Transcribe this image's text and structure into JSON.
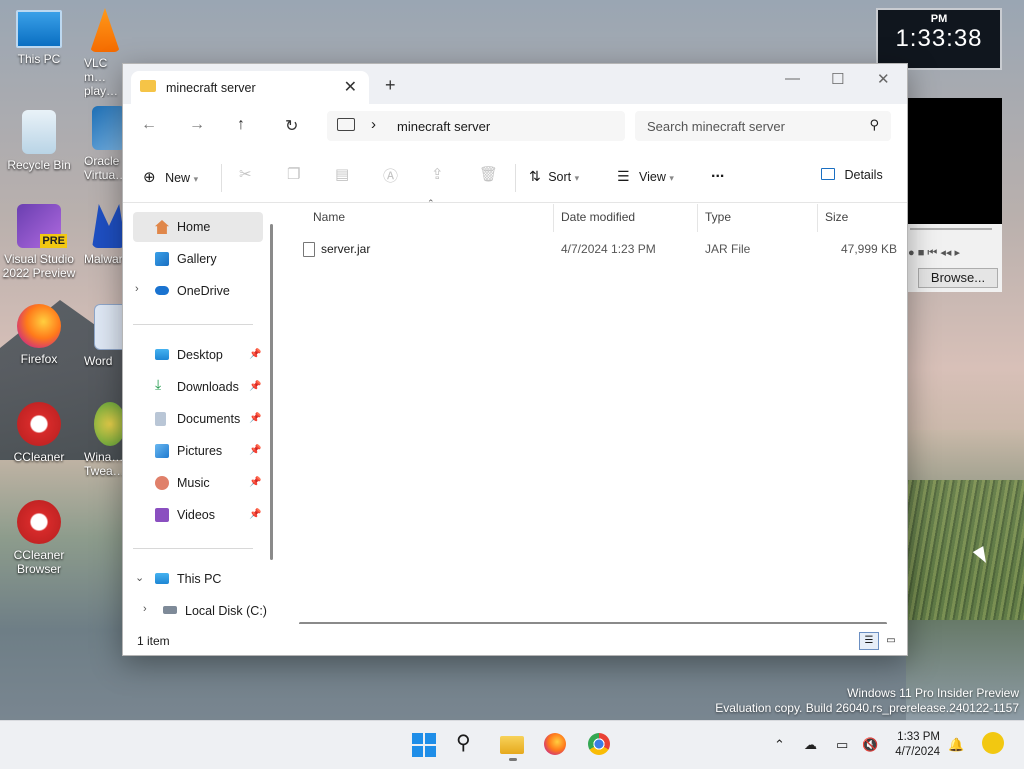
{
  "desktop": {
    "icons": [
      {
        "label": "This PC"
      },
      {
        "label": "VLC media player",
        "visible": "VLC m… play…"
      },
      {
        "label": "Recycle Bin"
      },
      {
        "label": "Oracle VirtualBox",
        "visible": "Oracle Virtua…"
      },
      {
        "label": "Visual Studio 2022 Preview"
      },
      {
        "label": "Malwarebytes",
        "visible": "Malwar…"
      },
      {
        "label": "Firefox"
      },
      {
        "label": "Word"
      },
      {
        "label": "CCleaner"
      },
      {
        "label": "Winaero Tweaker",
        "visible": "Wina… Twea…"
      },
      {
        "label": "CCleaner Browser"
      }
    ],
    "vs_badge": "PRE"
  },
  "clock_widget": {
    "ampm": "PM",
    "time": "1:33:38"
  },
  "media_player": {
    "browse_label": "Browse..."
  },
  "explorer": {
    "tab_title": "minecraft server",
    "address": "minecraft server",
    "search_placeholder": "Search minecraft server",
    "toolbar": {
      "new_label": "New",
      "sort_label": "Sort",
      "view_label": "View",
      "more_label": "...",
      "details_label": "Details"
    },
    "nav": {
      "home": "Home",
      "gallery": "Gallery",
      "onedrive": "OneDrive",
      "desktop": "Desktop",
      "downloads": "Downloads",
      "documents": "Documents",
      "pictures": "Pictures",
      "music": "Music",
      "videos": "Videos",
      "this_pc": "This PC",
      "local_disk": "Local Disk (C:)"
    },
    "columns": {
      "name": "Name",
      "date": "Date modified",
      "type": "Type",
      "size": "Size"
    },
    "files": [
      {
        "name": "server.jar",
        "date": "4/7/2024 1:23 PM",
        "type": "JAR File",
        "size": "47,999 KB"
      }
    ],
    "status": "1 item"
  },
  "watermark": {
    "line1": "Windows 11 Pro Insider Preview",
    "line2": "Evaluation copy. Build 26040.rs_prerelease.240122-1157"
  },
  "taskbar": {
    "time": "1:33 PM",
    "date": "4/7/2024"
  }
}
